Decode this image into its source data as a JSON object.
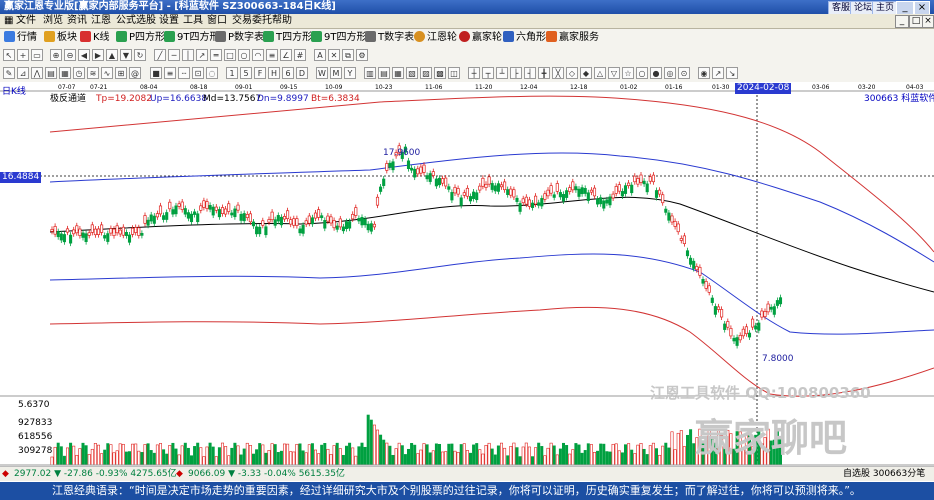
{
  "titlebar": {
    "title": "赢家江恩专业版[赢家内部服务平台] - [科蓝软件   SZ300663-184日K线]",
    "buttons": [
      "客服",
      "论坛",
      "主页"
    ],
    "win": [
      "_",
      "□",
      "×"
    ]
  },
  "menu": [
    "文件",
    "浏览",
    "资讯",
    "江恩",
    "公式选股",
    "设置",
    "工具",
    "窗口",
    "交易委托",
    "帮助"
  ],
  "toolbar": [
    "行情",
    "板块",
    "K线",
    "P四方形",
    "9T四方形",
    "P数字表",
    "T四方形",
    "9T四方形",
    "T数字表",
    "江恩轮",
    "赢家轮",
    "六角形",
    "赢家服务"
  ],
  "chart": {
    "period_label": "日K线",
    "indicator_name": "极反通道",
    "tp": "Tp=19.2082",
    "up": "Up=16.6638",
    "md": "Md=13.7567",
    "dn": "Dn=9.8997",
    "bt": "Bt=6.3834",
    "stock": "300663  科蓝软件",
    "cursor_price": "16.4884",
    "cursor_date": "2024-02-08",
    "high_label": "17.9600",
    "low_label": "7.8000",
    "dates": [
      "07-07",
      "07-21",
      "08-04",
      "08-18",
      "09-01",
      "09-15",
      "10-09",
      "10-23",
      "11-06",
      "11-20",
      "12-04",
      "12-18",
      "01-02",
      "01-16",
      "01-30",
      "2024-02-08",
      "03-06",
      "03-20",
      "04-03"
    ],
    "vol_ticks": [
      "5.6370",
      "927833",
      "618556",
      "309278"
    ],
    "watermark_1": "江恩工具软件 QQ:100800360",
    "watermark_2": "赢家聊吧"
  },
  "chart_data": {
    "type": "candlestick",
    "title": "",
    "channel_values": {
      "Tp": 19.2082,
      "Up": 16.6638,
      "Md": 13.7567,
      "Dn": 9.8997,
      "Bt": 6.3834
    },
    "annotations": [
      {
        "label": "17.9600",
        "kind": "high"
      },
      {
        "label": "7.8000",
        "kind": "low"
      }
    ],
    "cursor": {
      "date": "2024-02-08",
      "price": 16.4884
    }
  },
  "status": {
    "sh": "2977.02 ▼ -27.86 -0.93% 4275.65亿",
    "sz": "9066.09 ▼ -3.33 -0.04% 5615.35亿",
    "right": "自选股 300663分笔"
  },
  "footer": {
    "text": "江恩经典语录：“时间是决定市场走势的重要因素，经过详细研究大市及个别股票的过往记录，你将可以证明，历史确实重复发生；而了解过往，你将可以预测将来。”。"
  },
  "colors": {
    "up": "#e0201c",
    "down": "#00a040",
    "band_outer": "#d23434",
    "band_inner": "#2a3ad0",
    "title_bg": "#1f4fa8"
  }
}
